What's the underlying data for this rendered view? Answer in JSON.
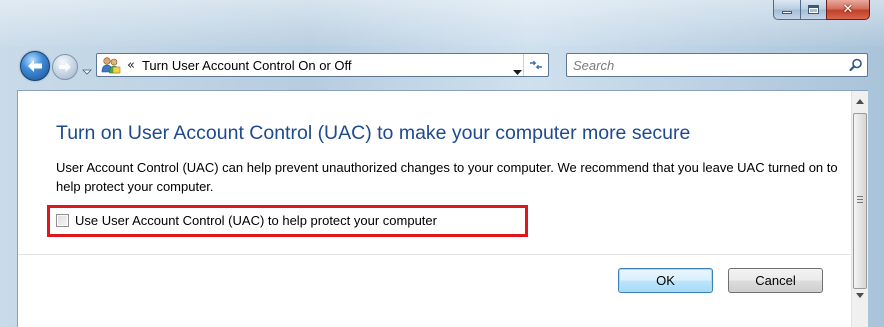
{
  "window": {
    "minimize_label": "minimize",
    "maximize_label": "maximize",
    "close_label": "close"
  },
  "navigation": {
    "address_prefix": "«",
    "address_text": "Turn User Account Control On or Off"
  },
  "search": {
    "placeholder": "Search"
  },
  "content": {
    "heading": "Turn on User Account Control (UAC) to make your computer more secure",
    "description": "User Account Control (UAC) can help prevent unauthorized changes to your computer.  We recommend that you leave UAC turned on to help protect your computer.",
    "checkbox_label": "Use User Account Control (UAC) to help protect your computer",
    "checkbox_checked": false
  },
  "buttons": {
    "ok": "OK",
    "cancel": "Cancel"
  },
  "colors": {
    "heading": "#1e4a8e",
    "highlight": "#e0161d",
    "close_button": "#c0402a"
  },
  "icons": [
    "back-arrow-icon",
    "forward-arrow-icon",
    "users-icon",
    "dropdown-arrow-icon",
    "refresh-icon",
    "search-icon",
    "minimize-icon",
    "maximize-icon",
    "close-icon"
  ]
}
